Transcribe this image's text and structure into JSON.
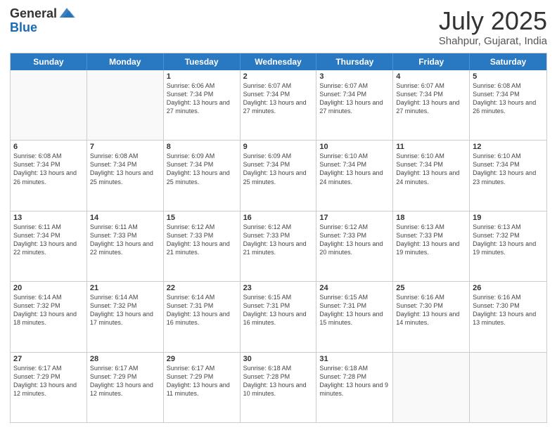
{
  "logo": {
    "general": "General",
    "blue": "Blue"
  },
  "title": "July 2025",
  "location": "Shahpur, Gujarat, India",
  "days_of_week": [
    "Sunday",
    "Monday",
    "Tuesday",
    "Wednesday",
    "Thursday",
    "Friday",
    "Saturday"
  ],
  "weeks": [
    [
      {
        "day": null,
        "sunrise": null,
        "sunset": null,
        "daylight": null
      },
      {
        "day": null,
        "sunrise": null,
        "sunset": null,
        "daylight": null
      },
      {
        "day": "1",
        "sunrise": "Sunrise: 6:06 AM",
        "sunset": "Sunset: 7:34 PM",
        "daylight": "Daylight: 13 hours and 27 minutes."
      },
      {
        "day": "2",
        "sunrise": "Sunrise: 6:07 AM",
        "sunset": "Sunset: 7:34 PM",
        "daylight": "Daylight: 13 hours and 27 minutes."
      },
      {
        "day": "3",
        "sunrise": "Sunrise: 6:07 AM",
        "sunset": "Sunset: 7:34 PM",
        "daylight": "Daylight: 13 hours and 27 minutes."
      },
      {
        "day": "4",
        "sunrise": "Sunrise: 6:07 AM",
        "sunset": "Sunset: 7:34 PM",
        "daylight": "Daylight: 13 hours and 27 minutes."
      },
      {
        "day": "5",
        "sunrise": "Sunrise: 6:08 AM",
        "sunset": "Sunset: 7:34 PM",
        "daylight": "Daylight: 13 hours and 26 minutes."
      }
    ],
    [
      {
        "day": "6",
        "sunrise": "Sunrise: 6:08 AM",
        "sunset": "Sunset: 7:34 PM",
        "daylight": "Daylight: 13 hours and 26 minutes."
      },
      {
        "day": "7",
        "sunrise": "Sunrise: 6:08 AM",
        "sunset": "Sunset: 7:34 PM",
        "daylight": "Daylight: 13 hours and 25 minutes."
      },
      {
        "day": "8",
        "sunrise": "Sunrise: 6:09 AM",
        "sunset": "Sunset: 7:34 PM",
        "daylight": "Daylight: 13 hours and 25 minutes."
      },
      {
        "day": "9",
        "sunrise": "Sunrise: 6:09 AM",
        "sunset": "Sunset: 7:34 PM",
        "daylight": "Daylight: 13 hours and 25 minutes."
      },
      {
        "day": "10",
        "sunrise": "Sunrise: 6:10 AM",
        "sunset": "Sunset: 7:34 PM",
        "daylight": "Daylight: 13 hours and 24 minutes."
      },
      {
        "day": "11",
        "sunrise": "Sunrise: 6:10 AM",
        "sunset": "Sunset: 7:34 PM",
        "daylight": "Daylight: 13 hours and 24 minutes."
      },
      {
        "day": "12",
        "sunrise": "Sunrise: 6:10 AM",
        "sunset": "Sunset: 7:34 PM",
        "daylight": "Daylight: 13 hours and 23 minutes."
      }
    ],
    [
      {
        "day": "13",
        "sunrise": "Sunrise: 6:11 AM",
        "sunset": "Sunset: 7:34 PM",
        "daylight": "Daylight: 13 hours and 22 minutes."
      },
      {
        "day": "14",
        "sunrise": "Sunrise: 6:11 AM",
        "sunset": "Sunset: 7:33 PM",
        "daylight": "Daylight: 13 hours and 22 minutes."
      },
      {
        "day": "15",
        "sunrise": "Sunrise: 6:12 AM",
        "sunset": "Sunset: 7:33 PM",
        "daylight": "Daylight: 13 hours and 21 minutes."
      },
      {
        "day": "16",
        "sunrise": "Sunrise: 6:12 AM",
        "sunset": "Sunset: 7:33 PM",
        "daylight": "Daylight: 13 hours and 21 minutes."
      },
      {
        "day": "17",
        "sunrise": "Sunrise: 6:12 AM",
        "sunset": "Sunset: 7:33 PM",
        "daylight": "Daylight: 13 hours and 20 minutes."
      },
      {
        "day": "18",
        "sunrise": "Sunrise: 6:13 AM",
        "sunset": "Sunset: 7:33 PM",
        "daylight": "Daylight: 13 hours and 19 minutes."
      },
      {
        "day": "19",
        "sunrise": "Sunrise: 6:13 AM",
        "sunset": "Sunset: 7:32 PM",
        "daylight": "Daylight: 13 hours and 19 minutes."
      }
    ],
    [
      {
        "day": "20",
        "sunrise": "Sunrise: 6:14 AM",
        "sunset": "Sunset: 7:32 PM",
        "daylight": "Daylight: 13 hours and 18 minutes."
      },
      {
        "day": "21",
        "sunrise": "Sunrise: 6:14 AM",
        "sunset": "Sunset: 7:32 PM",
        "daylight": "Daylight: 13 hours and 17 minutes."
      },
      {
        "day": "22",
        "sunrise": "Sunrise: 6:14 AM",
        "sunset": "Sunset: 7:31 PM",
        "daylight": "Daylight: 13 hours and 16 minutes."
      },
      {
        "day": "23",
        "sunrise": "Sunrise: 6:15 AM",
        "sunset": "Sunset: 7:31 PM",
        "daylight": "Daylight: 13 hours and 16 minutes."
      },
      {
        "day": "24",
        "sunrise": "Sunrise: 6:15 AM",
        "sunset": "Sunset: 7:31 PM",
        "daylight": "Daylight: 13 hours and 15 minutes."
      },
      {
        "day": "25",
        "sunrise": "Sunrise: 6:16 AM",
        "sunset": "Sunset: 7:30 PM",
        "daylight": "Daylight: 13 hours and 14 minutes."
      },
      {
        "day": "26",
        "sunrise": "Sunrise: 6:16 AM",
        "sunset": "Sunset: 7:30 PM",
        "daylight": "Daylight: 13 hours and 13 minutes."
      }
    ],
    [
      {
        "day": "27",
        "sunrise": "Sunrise: 6:17 AM",
        "sunset": "Sunset: 7:29 PM",
        "daylight": "Daylight: 13 hours and 12 minutes."
      },
      {
        "day": "28",
        "sunrise": "Sunrise: 6:17 AM",
        "sunset": "Sunset: 7:29 PM",
        "daylight": "Daylight: 13 hours and 12 minutes."
      },
      {
        "day": "29",
        "sunrise": "Sunrise: 6:17 AM",
        "sunset": "Sunset: 7:29 PM",
        "daylight": "Daylight: 13 hours and 11 minutes."
      },
      {
        "day": "30",
        "sunrise": "Sunrise: 6:18 AM",
        "sunset": "Sunset: 7:28 PM",
        "daylight": "Daylight: 13 hours and 10 minutes."
      },
      {
        "day": "31",
        "sunrise": "Sunrise: 6:18 AM",
        "sunset": "Sunset: 7:28 PM",
        "daylight": "Daylight: 13 hours and 9 minutes."
      },
      {
        "day": null,
        "sunrise": null,
        "sunset": null,
        "daylight": null
      },
      {
        "day": null,
        "sunrise": null,
        "sunset": null,
        "daylight": null
      }
    ]
  ]
}
